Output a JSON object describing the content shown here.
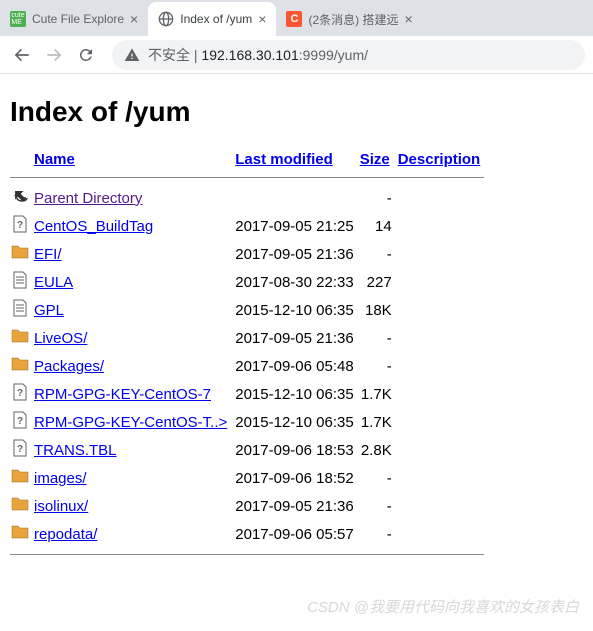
{
  "tabs": [
    {
      "title": "Cute File Explore",
      "favicon": "cute"
    },
    {
      "title": "Index of /yum",
      "favicon": "globe",
      "active": true
    },
    {
      "title": "(2条消息) 搭建远",
      "favicon": "csdn"
    }
  ],
  "toolbar": {
    "insecure_label": "不安全",
    "url_host": "192.168.30.101",
    "url_port": ":9999",
    "url_path": "/yum/"
  },
  "page": {
    "heading": "Index of /yum",
    "columns": {
      "name": "Name",
      "modified": "Last modified",
      "size": "Size",
      "description": "Description"
    },
    "rows": [
      {
        "icon": "back",
        "name": "Parent Directory",
        "modified": "",
        "size": "-",
        "visited": true
      },
      {
        "icon": "unknown",
        "name": "CentOS_BuildTag",
        "modified": "2017-09-05 21:25",
        "size": "14"
      },
      {
        "icon": "folder",
        "name": "EFI/",
        "modified": "2017-09-05 21:36",
        "size": "-"
      },
      {
        "icon": "text",
        "name": "EULA",
        "modified": "2017-08-30 22:33",
        "size": "227"
      },
      {
        "icon": "text",
        "name": "GPL",
        "modified": "2015-12-10 06:35",
        "size": "18K"
      },
      {
        "icon": "folder",
        "name": "LiveOS/",
        "modified": "2017-09-05 21:36",
        "size": "-"
      },
      {
        "icon": "folder",
        "name": "Packages/",
        "modified": "2017-09-06 05:48",
        "size": "-"
      },
      {
        "icon": "unknown",
        "name": "RPM-GPG-KEY-CentOS-7",
        "modified": "2015-12-10 06:35",
        "size": "1.7K"
      },
      {
        "icon": "unknown",
        "name": "RPM-GPG-KEY-CentOS-T..>",
        "modified": "2015-12-10 06:35",
        "size": "1.7K"
      },
      {
        "icon": "unknown",
        "name": "TRANS.TBL",
        "modified": "2017-09-06 18:53",
        "size": "2.8K"
      },
      {
        "icon": "folder",
        "name": "images/",
        "modified": "2017-09-06 18:52",
        "size": "-"
      },
      {
        "icon": "folder",
        "name": "isolinux/",
        "modified": "2017-09-05 21:36",
        "size": "-"
      },
      {
        "icon": "folder",
        "name": "repodata/",
        "modified": "2017-09-06 05:57",
        "size": "-"
      }
    ]
  },
  "watermark": "CSDN @我要用代码向我喜欢的女孩表白"
}
